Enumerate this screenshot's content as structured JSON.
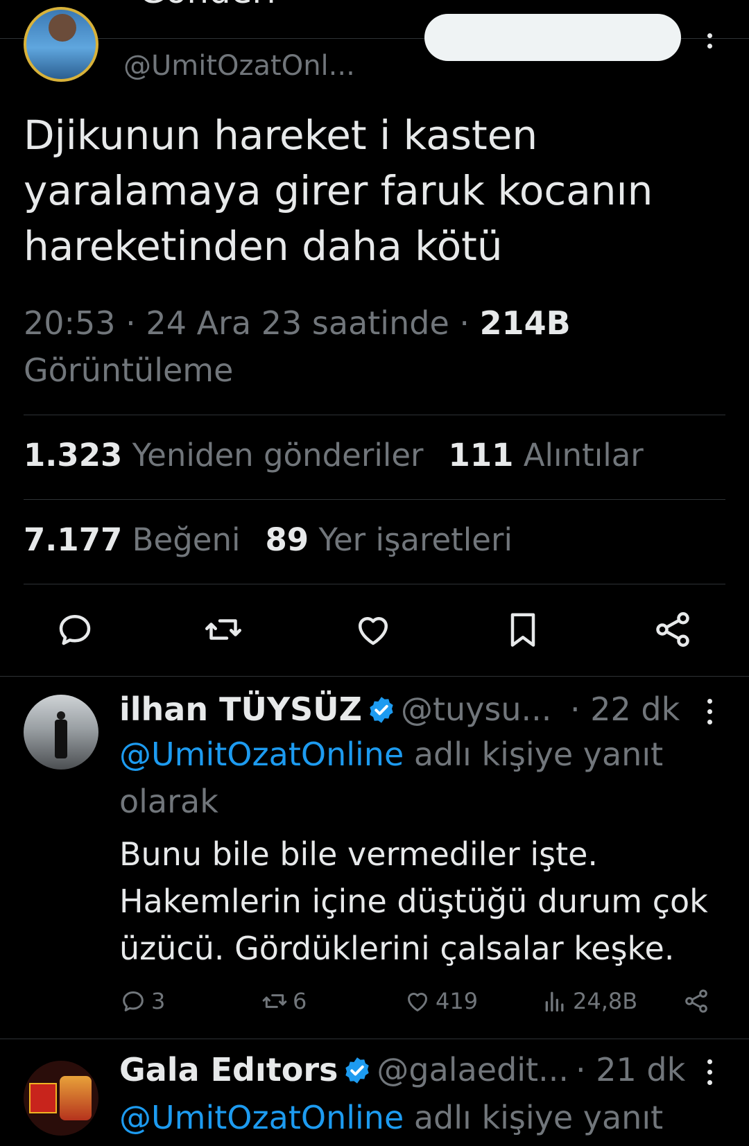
{
  "header": {
    "title_fragment": "Gönderi"
  },
  "tweet": {
    "handle": "@UmitOzatOnl...",
    "text_lines": [
      "Djikunun hareket i kasten",
      "yaralamaya girer faruk kocanın",
      "hareketinden daha kötü"
    ],
    "time_date": "20:53 · 24 Ara 23 saatinde · ",
    "views_count": "214B",
    "views_label": "Görüntüleme",
    "reposts_count": "1.323",
    "reposts_label": "Yeniden gönderiler",
    "quotes_count": "111",
    "quotes_label": "Alıntılar",
    "likes_count": "7.177",
    "likes_label": "Beğeni",
    "bookmarks_count": "89",
    "bookmarks_label": "Yer işaretleri"
  },
  "icons": [
    "reply-icon",
    "repost-icon",
    "like-icon",
    "bookmark-icon",
    "share-icon",
    "views-icon",
    "verified-icon",
    "more-icon"
  ],
  "colors": {
    "background": "#000000",
    "text": "#e7e9ea",
    "muted": "#71767b",
    "accent": "#1d9bf0",
    "divider": "#2f3336"
  },
  "replies": [
    {
      "name": "ilhan TÜYSÜZ",
      "handle": "@tuysu...",
      "time": "· 22 dk",
      "reply_to_mention": "@UmitOzatOnline",
      "reply_to_suffix": " adlı kişiye yanıt",
      "reply_to_line2": "olarak",
      "body_lines": [
        "Bunu bile bile vermediler işte.",
        "Hakemlerin içine düştüğü durum çok",
        "üzücü. Gördüklerini çalsalar keşke."
      ],
      "reply_count": "3",
      "repost_count": "6",
      "like_count": "419",
      "view_count": "24,8B"
    },
    {
      "name": "Gala Edıtors",
      "handle": "@galaedit...",
      "time": "· 21 dk",
      "reply_to_mention": "@UmitOzatOnline",
      "reply_to_suffix": " adlı kişiye yanıt"
    }
  ]
}
